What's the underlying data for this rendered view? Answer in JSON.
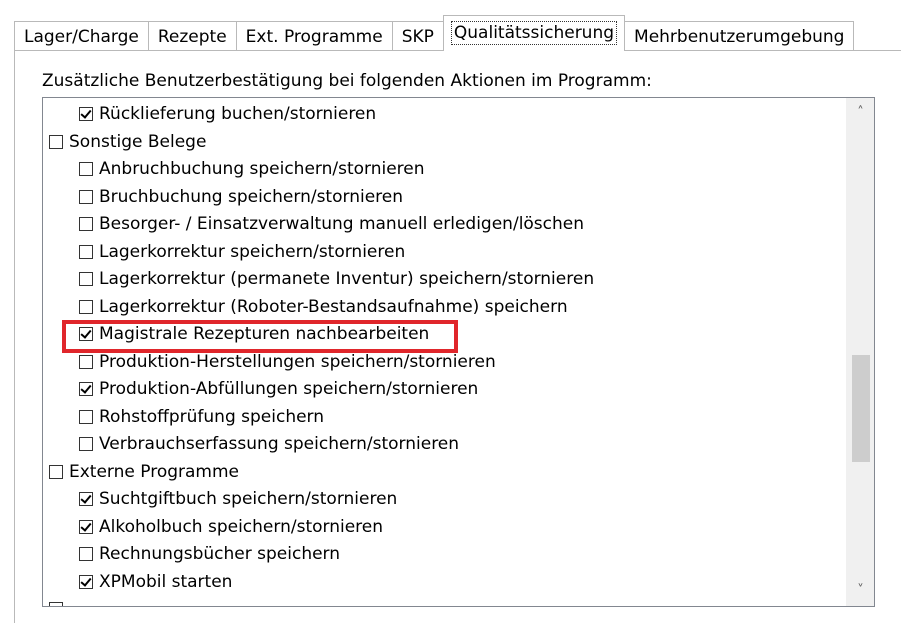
{
  "tabs": [
    {
      "label": "Lager/Charge"
    },
    {
      "label": "Rezepte"
    },
    {
      "label": "Ext. Programme"
    },
    {
      "label": "SKP"
    },
    {
      "label": "Qualitätssicherung"
    },
    {
      "label": "Mehrbenutzerumgebung"
    }
  ],
  "active_tab": "Qualitätssicherung",
  "caption": "Zusätzliche Benutzerbestätigung bei folgenden Aktionen im Programm:",
  "items": [
    {
      "label": "Rücklieferung buchen/stornieren",
      "checked": true
    },
    {
      "label": "Sonstige Belege",
      "checked": false
    },
    {
      "label": "Anbruchbuchung speichern/stornieren",
      "checked": false
    },
    {
      "label": "Bruchbuchung speichern/stornieren",
      "checked": false
    },
    {
      "label": "Besorger- / Einsatzverwaltung manuell erledigen/löschen",
      "checked": false
    },
    {
      "label": "Lagerkorrektur speichern/stornieren",
      "checked": false
    },
    {
      "label": "Lagerkorrektur (permanete Inventur) speichern/stornieren",
      "checked": false
    },
    {
      "label": "Lagerkorrektur (Roboter-Bestandsaufnahme) speichern",
      "checked": false
    },
    {
      "label": "Magistrale Rezepturen nachbearbeiten",
      "checked": true
    },
    {
      "label": "Produktion-Herstellungen speichern/stornieren",
      "checked": false
    },
    {
      "label": "Produktion-Abfüllungen speichern/stornieren",
      "checked": true
    },
    {
      "label": "Rohstoffprüfung speichern",
      "checked": false
    },
    {
      "label": "Verbrauchserfassung speichern/stornieren",
      "checked": false
    },
    {
      "label": "Externe Programme",
      "checked": false
    },
    {
      "label": "Suchtgiftbuch speichern/stornieren",
      "checked": true
    },
    {
      "label": "Alkoholbuch speichern/stornieren",
      "checked": true
    },
    {
      "label": "Rechnungsbücher speichern",
      "checked": false
    },
    {
      "label": "XPMobil starten",
      "checked": true
    }
  ],
  "scrollbar": {
    "up_glyph": "˄",
    "down_glyph": "˅",
    "position_fraction": 0.6
  },
  "colors": {
    "highlight": "#e0262b"
  }
}
